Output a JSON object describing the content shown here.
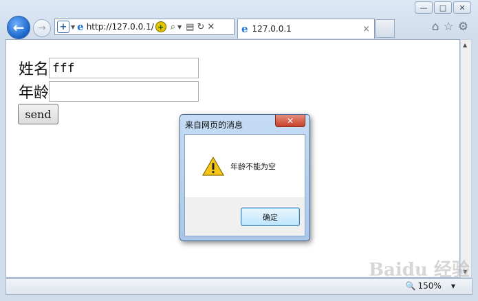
{
  "window": {
    "minimize_glyph": "—",
    "maximize_glyph": "□",
    "close_glyph": "✕"
  },
  "nav": {
    "back_glyph": "←",
    "forward_glyph": "→",
    "address": "http://127.0.0.1/",
    "tab_title": "127.0.0.1",
    "tab_close": "×",
    "icons": [
      "home-icon",
      "favorites-star-icon",
      "settings-gear-icon"
    ]
  },
  "page": {
    "name_label": "姓名",
    "name_value": "fff",
    "age_label": "年龄",
    "age_value": "",
    "send_label": "send"
  },
  "dialog": {
    "title": "来自网页的消息",
    "close_glyph": "✕",
    "message": "年龄不能为空",
    "ok_label": "确定"
  },
  "status": {
    "zoom": "150%"
  },
  "watermark": "Baidu 经验",
  "colors": {
    "accent": "#1a64c8",
    "dialog_frame": "#a9c8ea",
    "close_red": "#c8412b"
  }
}
